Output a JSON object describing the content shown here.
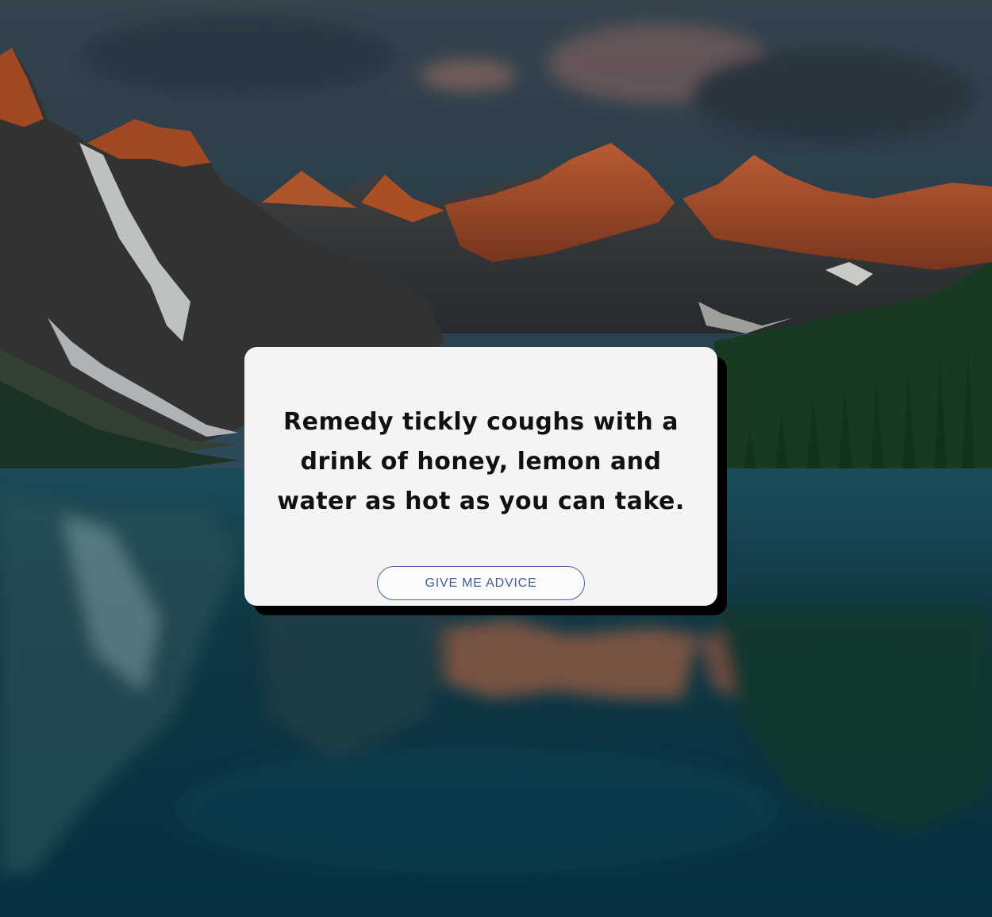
{
  "background": {
    "description_icon": "mountain-lake-landscape",
    "sky_color": "#3b4f5f",
    "peak_color": "#c25a2c",
    "forest_color": "#1f4a2c",
    "water_color": "#0d4a5a"
  },
  "card": {
    "advice": "Remedy tickly coughs with a drink of honey, lemon and water as hot as you can take.",
    "button_label": "GIVE ME ADVICE"
  },
  "colors": {
    "card_bg": "#f4f4f4",
    "button_border": "#3f66a6",
    "button_text": "#3f5f95",
    "shadow": "#000000"
  }
}
